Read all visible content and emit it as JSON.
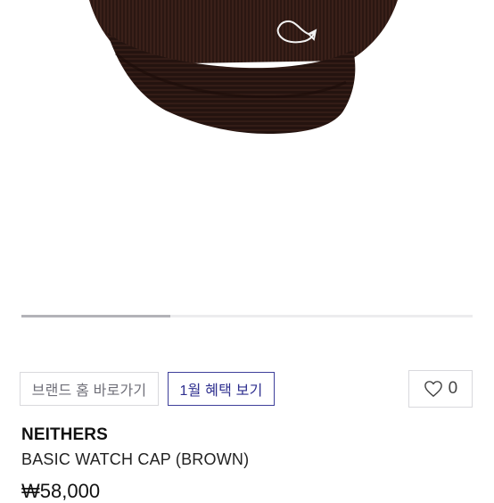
{
  "product_image": {
    "alt": "brown knit watch cap"
  },
  "carousel": {
    "progress_fraction": 0.33
  },
  "actions": {
    "brand_home_label": "브랜드 홈 바로가기",
    "benefit_label": "1월 혜택 보기",
    "like_count": "0",
    "like_icon": "heart-outline-icon"
  },
  "product": {
    "brand": "NEITHERS",
    "name": "BASIC WATCH CAP (BROWN)",
    "price": "₩58,000"
  },
  "colors": {
    "hat": "#2a1611",
    "accent": "#2e2f8f",
    "border": "#d9d9dd"
  }
}
